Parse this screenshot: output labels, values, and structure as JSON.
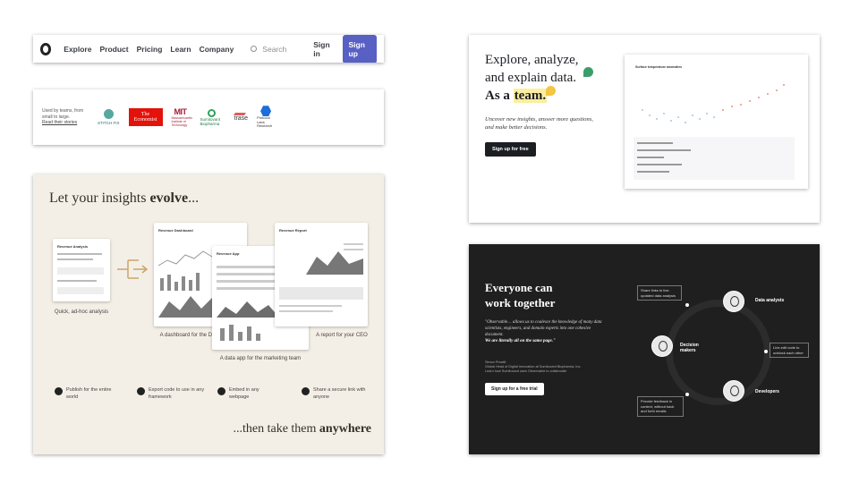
{
  "nav": {
    "links": [
      "Explore",
      "Product",
      "Pricing",
      "Learn",
      "Company"
    ],
    "search_placeholder": "Search",
    "signin": "Sign in",
    "signup": "Sign up"
  },
  "logos": {
    "used_by": "Used by teams, from small to large.",
    "read_stories": "Read their stories",
    "stitchfix": "STITCH FIX",
    "economist_1": "The",
    "economist_2": "Economist",
    "mit_mark": "MIT",
    "mit_text": "Massachusetts Institute of Technology",
    "sumitovant": "Sumitovant Biopharma",
    "trase": "trase",
    "protocol_labs": "Protocol Labs Research"
  },
  "evolve": {
    "title_pre": "Let your insights ",
    "title_bold": "evolve",
    "title_post": "...",
    "adhoc_title": "Revenue Analysis",
    "adhoc_caption": "Quick, ad-hoc analysis",
    "dashboard_title": "Revenue Dashboard",
    "dashboard_caption": "A dashboard for the DevOps team",
    "app_title": "Revenue App",
    "app_caption": "A data app for the marketing team",
    "report_title": "Revenue Report",
    "report_caption": "A report for your CEO",
    "features": [
      "Publish for the entire world",
      "Export code to use in any framework",
      "Embed in any webpage",
      "Share a secure link with anyone"
    ],
    "tagline_pre": "...then take them ",
    "tagline_bold": "anywhere"
  },
  "hero": {
    "line1": "Explore, analyze,",
    "line2": "and explain data.",
    "line3_pre": "As a ",
    "line3_team": "team.",
    "subtitle": "Uncover new insights, answer more questions, and make better decisions.",
    "cta": "Sign up for free",
    "chart_title": "Surface temperature anomalies"
  },
  "collab": {
    "title_1": "Everyone can",
    "title_2": "work together",
    "quote": "\"Observable… allows us to coalesce the knowledge of many data scientists, engineers, and domain experts into one cohesive document.",
    "quote_bold": "We are literally all on the same page.\"",
    "attr_name": "Simon Prewitt",
    "attr_role": "Global Head of Digital Innovation at Sumitovant Biopharma, Inc.",
    "attr_link": "Learn how Sumitovant uses Observable to collaborate",
    "cta": "Sign up for a free trial",
    "roles": [
      "Data analysts",
      "Decision makers",
      "Developers"
    ],
    "notes": [
      "Share links to live-updated data analysis",
      "Live-edit code to unblock each other",
      "Provide feedback in context, without back and forth emails"
    ]
  }
}
